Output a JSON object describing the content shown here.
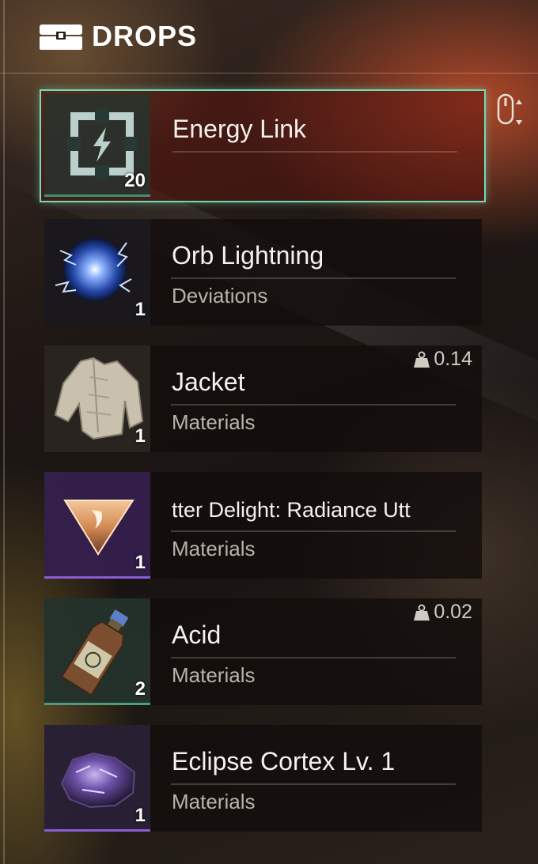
{
  "header": {
    "title": "DROPS",
    "icon": "chest-icon"
  },
  "items": [
    {
      "name": "Energy Link",
      "category": "",
      "quantity": "20",
      "weight": "",
      "icon": "energy-link-icon",
      "selected": true,
      "rarity_color": "#3e8f74"
    },
    {
      "name": "Orb Lightning",
      "category": "Deviations",
      "quantity": "1",
      "weight": "",
      "icon": "orb-lightning-icon",
      "selected": false,
      "rarity_color": ""
    },
    {
      "name": "Jacket",
      "category": "Materials",
      "quantity": "1",
      "weight": "0.14",
      "icon": "jacket-icon",
      "selected": false,
      "rarity_color": ""
    },
    {
      "name": "tter Delight: Radiance   Utt",
      "category": "Materials",
      "quantity": "1",
      "weight": "",
      "icon": "radiance-crystal-icon",
      "selected": false,
      "rarity_color": "#8a5cd6"
    },
    {
      "name": "Acid",
      "category": "Materials",
      "quantity": "2",
      "weight": "0.02",
      "icon": "acid-bottle-icon",
      "selected": false,
      "rarity_color": "#4f9b7e"
    },
    {
      "name": "Eclipse Cortex Lv. 1",
      "category": "Materials",
      "quantity": "1",
      "weight": "",
      "icon": "eclipse-cortex-icon",
      "selected": false,
      "rarity_color": "#8a5cd6"
    }
  ],
  "controls": {
    "scroll_hint_icon": "mouse-scroll-icon"
  }
}
